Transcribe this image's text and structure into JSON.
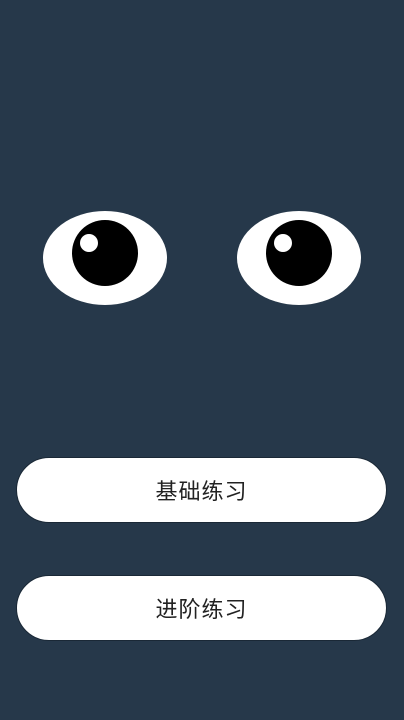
{
  "colors": {
    "background": "#26384a",
    "eye_white": "#ffffff",
    "pupil": "#000000",
    "button_background": "#ffffff",
    "button_text": "#222222"
  },
  "eyes": [
    {
      "name": "left-eye",
      "gaze": "up-left"
    },
    {
      "name": "right-eye",
      "gaze": "up-left"
    }
  ],
  "menu": {
    "basic_practice_label": "基础练习",
    "advanced_practice_label": "进阶练习"
  }
}
